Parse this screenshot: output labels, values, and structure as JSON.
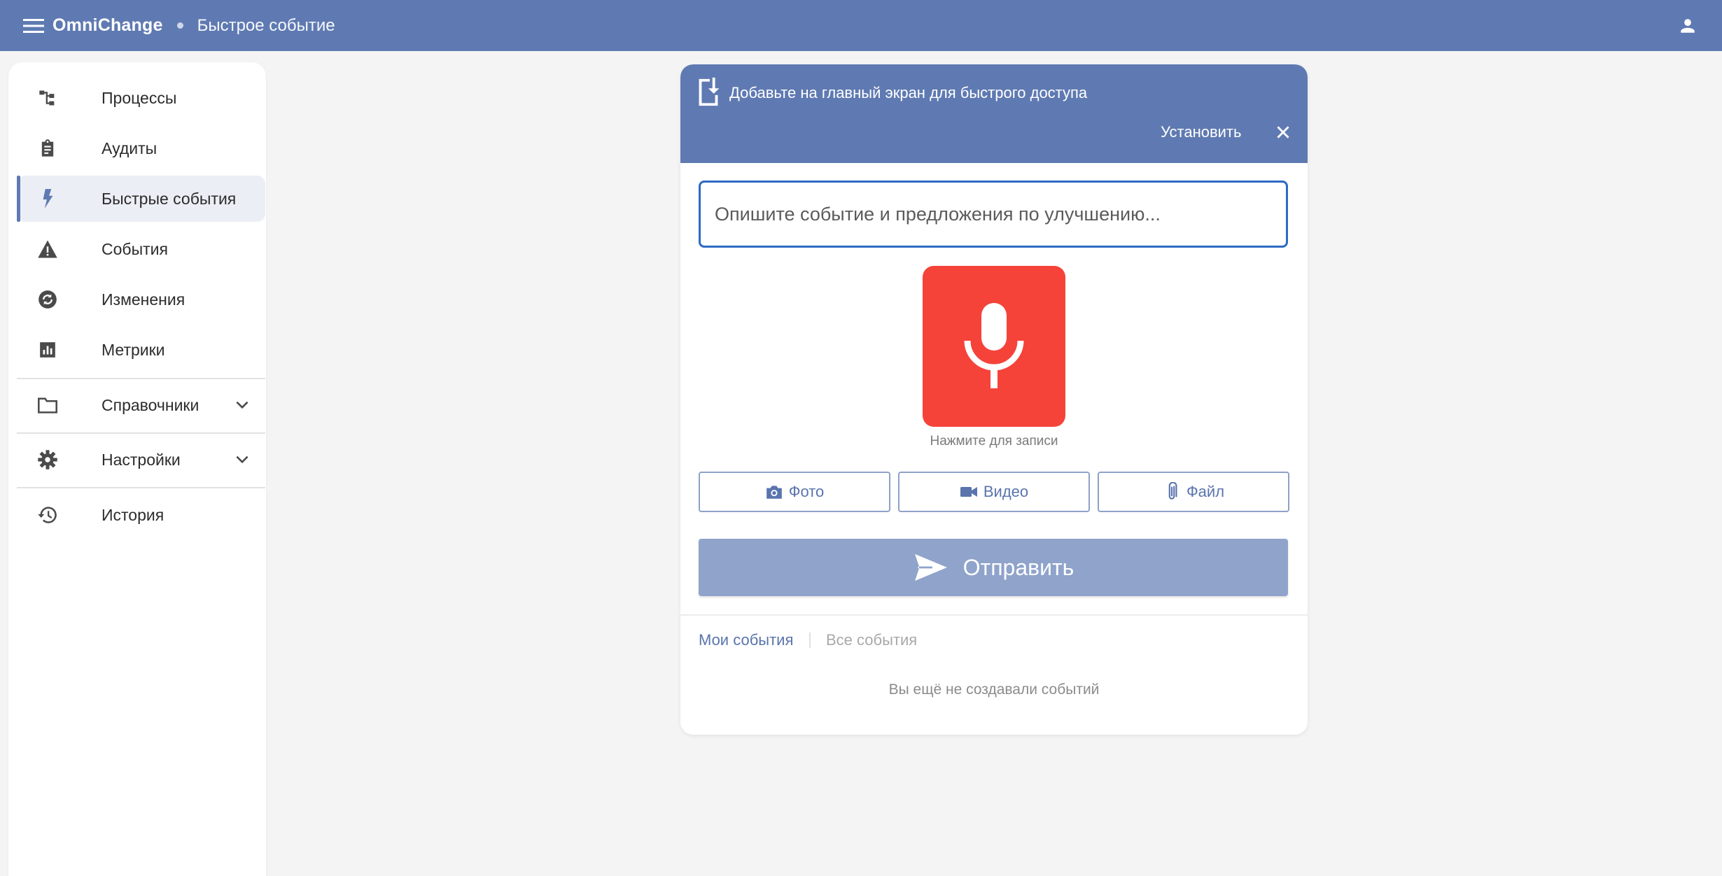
{
  "header": {
    "brand": "OmniChange",
    "breadcrumb": "Быстрое событие"
  },
  "sidebar": {
    "items": [
      {
        "label": "Процессы",
        "icon": "process-tree-icon"
      },
      {
        "label": "Аудиты",
        "icon": "clipboard-icon"
      },
      {
        "label": "Быстрые события",
        "icon": "bolt-icon",
        "active": true
      },
      {
        "label": "События",
        "icon": "warning-icon"
      },
      {
        "label": "Изменения",
        "icon": "sync-icon"
      },
      {
        "label": "Метрики",
        "icon": "chart-icon"
      },
      {
        "label": "Справочники",
        "icon": "folder-icon",
        "expandable": true
      },
      {
        "label": "Настройки",
        "icon": "gear-icon",
        "expandable": true
      },
      {
        "label": "История",
        "icon": "history-icon"
      }
    ]
  },
  "install_banner": {
    "text": "Добавьте на главный экран для быстрого доступа",
    "install_label": "Установить"
  },
  "form": {
    "placeholder": "Опишите событие и предложения по улучшению...",
    "value": "",
    "mic_hint": "Нажмите для записи",
    "photo_label": "Фото",
    "video_label": "Видео",
    "file_label": "Файл",
    "send_label": "Отправить"
  },
  "tabs": {
    "mine": "Мои события",
    "all": "Все события"
  },
  "empty_state": "Вы ещё не создавали событий",
  "colors": {
    "primary": "#5f7ab2",
    "mic": "#f5433a",
    "send_disabled": "#8fa3cb",
    "input_focus": "#2d6ac4"
  }
}
